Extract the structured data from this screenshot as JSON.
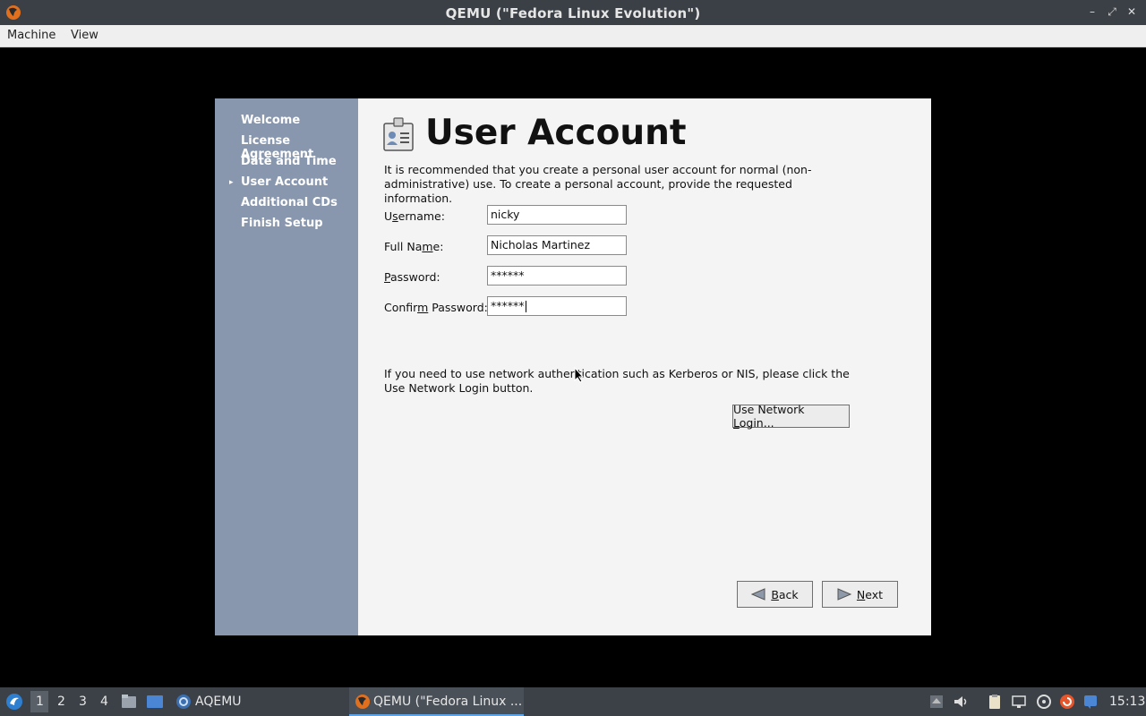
{
  "window": {
    "title": "QEMU (\"Fedora Linux Evolution\")",
    "controls": [
      "–",
      "⤢",
      "✕"
    ]
  },
  "menubar": {
    "items": [
      "Machine",
      "View"
    ]
  },
  "installer": {
    "steps": [
      "Welcome",
      "License Agreement",
      "Date and Time",
      "User Account",
      "Additional CDs",
      "Finish Setup"
    ],
    "current_step": "User Account",
    "heading": "User Account",
    "description": "It is recommended that you create a personal user account for normal (non-administrative) use.  To create a personal account, provide the requested information.",
    "fields": {
      "username": {
        "label_pre": "U",
        "label_mid": "s",
        "label_post": "ername:",
        "value": "nicky"
      },
      "fullname": {
        "label_pre": "Full Na",
        "label_mid": "m",
        "label_post": "e:",
        "value": "Nicholas Martinez"
      },
      "password": {
        "label_pre": "",
        "label_mid": "P",
        "label_post": "assword:",
        "value": "******"
      },
      "confirm": {
        "label_pre": "Confir",
        "label_mid": "m",
        "label_post": " Password:",
        "value": "******"
      }
    },
    "network_text_1": "If you need to use network authentication such as Kerberos or NIS, please click the",
    "network_text_2": "Use Network Login button.",
    "network_button_pre": "Use Network ",
    "network_button_mid": "L",
    "network_button_post": "ogin...",
    "back_pre": "",
    "back_mid": "B",
    "back_post": "ack",
    "next_pre": "",
    "next_mid": "N",
    "next_post": "ext"
  },
  "taskbar": {
    "workspaces": [
      "1",
      "2",
      "3",
      "4"
    ],
    "active_workspace": "1",
    "tasks": [
      "AQEMU",
      "QEMU (\"Fedora Linux ..."
    ],
    "clock": "15:13"
  }
}
